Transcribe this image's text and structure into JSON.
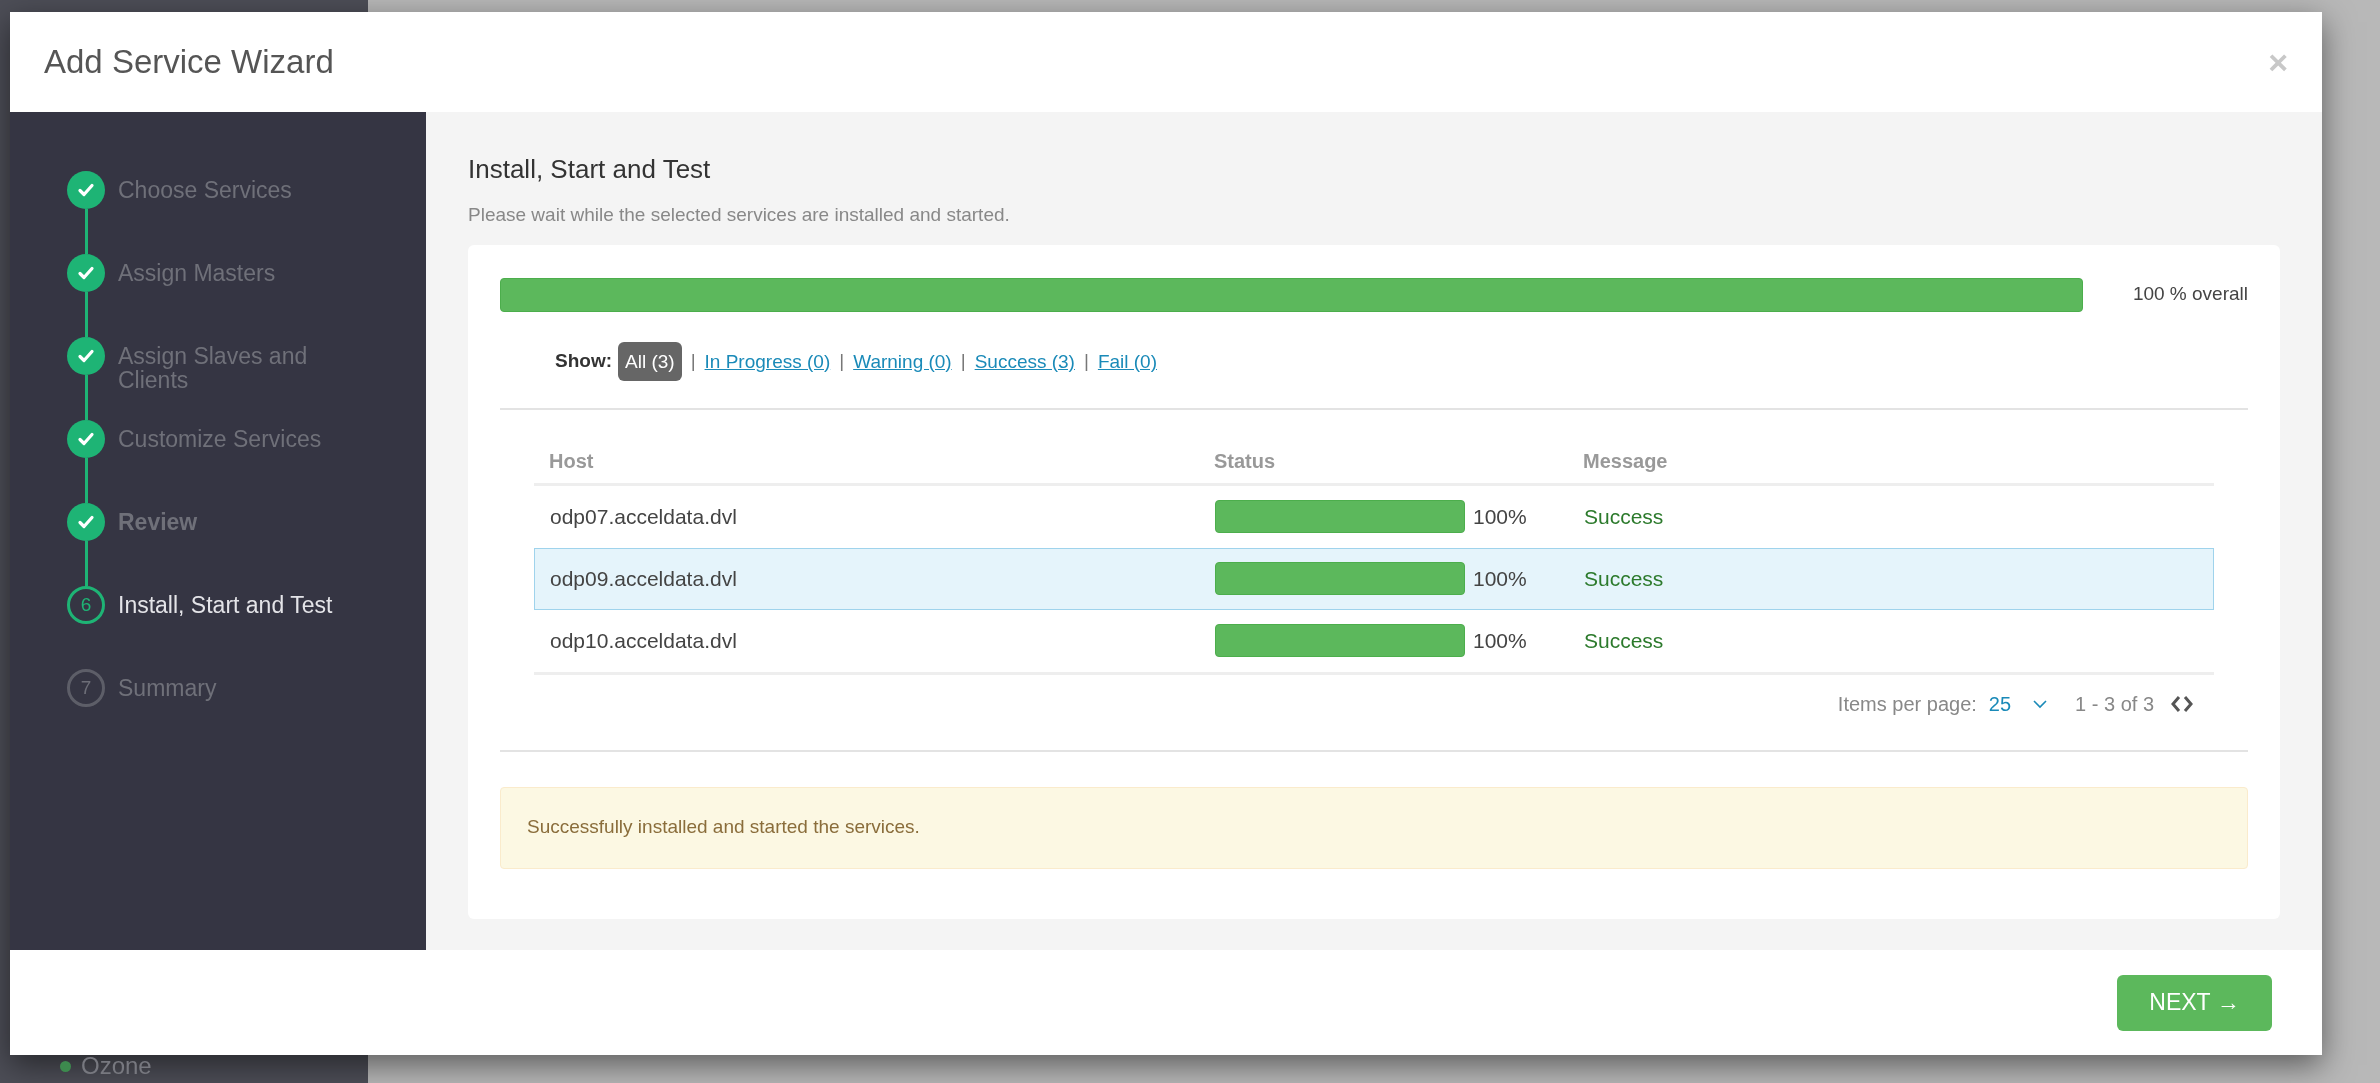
{
  "background": {
    "sidebar_item": {
      "label": "Ozone",
      "color": "#3d8a4e"
    }
  },
  "modal": {
    "title": "Add Service Wizard",
    "close": "×"
  },
  "steps": [
    {
      "label": "Choose Services",
      "kind": "done",
      "emphasized": false
    },
    {
      "label": "Assign Masters",
      "kind": "done",
      "emphasized": false
    },
    {
      "label": "Assign Slaves and Clients",
      "kind": "done",
      "emphasized": false
    },
    {
      "label": "Customize Services",
      "kind": "done",
      "emphasized": false
    },
    {
      "label": "Review",
      "kind": "done",
      "emphasized": true
    },
    {
      "label": "Install, Start and Test",
      "kind": "current",
      "marker": "6",
      "emphasized": false
    },
    {
      "label": "Summary",
      "kind": "pending",
      "marker": "7",
      "emphasized": false
    }
  ],
  "content": {
    "heading": "Install, Start and Test",
    "subtitle": "Please wait while the selected services are installed and started.",
    "overall": {
      "level": 1,
      "reading": "100 % overall"
    },
    "filter": {
      "label": "Show:",
      "separators": [
        "|",
        "|",
        "|",
        "|"
      ],
      "options": [
        {
          "label": "All (3)",
          "selected": true
        },
        {
          "label": "In Progress (0)",
          "selected": false
        },
        {
          "label": "Warning (0)",
          "selected": false
        },
        {
          "label": "Success (3)",
          "selected": false
        },
        {
          "label": "Fail (0)",
          "selected": false
        }
      ]
    },
    "table": {
      "columns": [
        "Host",
        "Status",
        "Message"
      ],
      "rows": [
        {
          "host": "odp07.acceldata.dvl",
          "level": 1,
          "reading": "100%",
          "message": "Success",
          "selected": false
        },
        {
          "host": "odp09.acceldata.dvl",
          "level": 1,
          "reading": "100%",
          "message": "Success",
          "selected": true
        },
        {
          "host": "odp10.acceldata.dvl",
          "level": 1,
          "reading": "100%",
          "message": "Success",
          "selected": false
        }
      ]
    },
    "pagination": {
      "label": "Items per page:",
      "per_page": "25",
      "range": "1 - 3 of 3"
    },
    "alert": "Successfully installed and started the services."
  },
  "footer": {
    "next": "NEXT →"
  }
}
